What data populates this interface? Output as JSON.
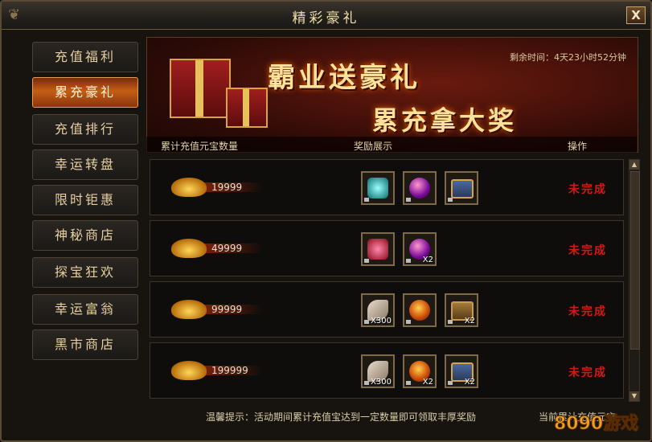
{
  "window": {
    "title": "精彩豪礼",
    "close_label": "X"
  },
  "sidebar": {
    "items": [
      {
        "label": "充值福利",
        "active": false
      },
      {
        "label": "累充豪礼",
        "active": true
      },
      {
        "label": "充值排行",
        "active": false
      },
      {
        "label": "幸运转盘",
        "active": false
      },
      {
        "label": "限时钜惠",
        "active": false
      },
      {
        "label": "神秘商店",
        "active": false
      },
      {
        "label": "探宝狂欢",
        "active": false
      },
      {
        "label": "幸运富翁",
        "active": false
      },
      {
        "label": "黑市商店",
        "active": false
      }
    ]
  },
  "banner": {
    "line1": "霸业送豪礼",
    "line2": "累充拿大奖",
    "timer": "剩余时间：4天23小时52分钟"
  },
  "table": {
    "headers": [
      "累计充值元宝数量",
      "奖励展示",
      "操作"
    ],
    "rows": [
      {
        "amount": "19999",
        "status": "未完成",
        "rewards": [
          {
            "icon": "crystal-icon",
            "qty": ""
          },
          {
            "icon": "purple-orb-icon",
            "qty": ""
          },
          {
            "icon": "treasure-chest-icon",
            "qty": ""
          }
        ]
      },
      {
        "amount": "49999",
        "status": "未完成",
        "rewards": [
          {
            "icon": "red-crystal-icon",
            "qty": ""
          },
          {
            "icon": "purple-orb-icon",
            "qty": "X2"
          }
        ]
      },
      {
        "amount": "99999",
        "status": "未完成",
        "rewards": [
          {
            "icon": "feather-icon",
            "qty": "X300"
          },
          {
            "icon": "fire-orb-icon",
            "qty": ""
          },
          {
            "icon": "wooden-chest-icon",
            "qty": "X2"
          }
        ]
      },
      {
        "amount": "199999",
        "status": "未完成",
        "rewards": [
          {
            "icon": "feather-icon",
            "qty": "X300"
          },
          {
            "icon": "fire-orb-icon",
            "qty": "X2"
          },
          {
            "icon": "blue-chest-icon",
            "qty": "X2"
          }
        ]
      }
    ]
  },
  "footer": {
    "hint": "温馨提示：活动期间累计充值宝达到一定数量即可领取丰厚奖励",
    "current": "当前累计充值元宝"
  },
  "watermark": "8090游戏",
  "colors": {
    "accent": "#c35e14",
    "status_red": "#d21a12",
    "gold_text": "#ffe29a"
  }
}
